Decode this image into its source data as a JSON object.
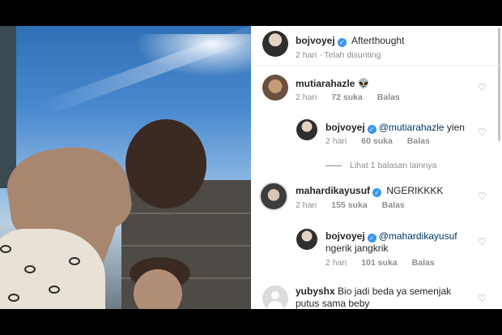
{
  "post": {
    "author": "bojvoyej",
    "caption": "Afterthought",
    "meta": "2 hari · Telah disunting"
  },
  "comments": [
    {
      "username": "mutiarahazle",
      "text": "👽",
      "time": "2 hari",
      "likes": "72 suka",
      "reply": "Balas",
      "verified": false
    },
    {
      "username": "bojvoyej",
      "mention": "@mutiarahazle",
      "text": " yien",
      "time": "2 hari",
      "likes": "60 suka",
      "reply": "Balas",
      "verified": true
    },
    {
      "more_replies": "Lihat 1 balasan lainnya"
    },
    {
      "username": "mahardikayusuf",
      "text": "NGERIKKKK",
      "time": "2 hari",
      "likes": "155 suka",
      "reply": "Balas",
      "verified": true
    },
    {
      "username": "bojvoyej",
      "mention": "@mahardikayusuf",
      "text": "ngerik jangkrik",
      "time": "2 hari",
      "likes": "101 suka",
      "reply": "Balas",
      "verified": true
    },
    {
      "username": "yubyshx",
      "text": "Bio jadi beda ya semenjak putus sama beby",
      "verified": false
    }
  ],
  "icons": {
    "verified": "verified-badge-icon",
    "like": "heart-icon"
  },
  "colors": {
    "verified_blue": "#3897f0",
    "meta_gray": "#8e8e8e",
    "mention_blue": "#00376b"
  }
}
